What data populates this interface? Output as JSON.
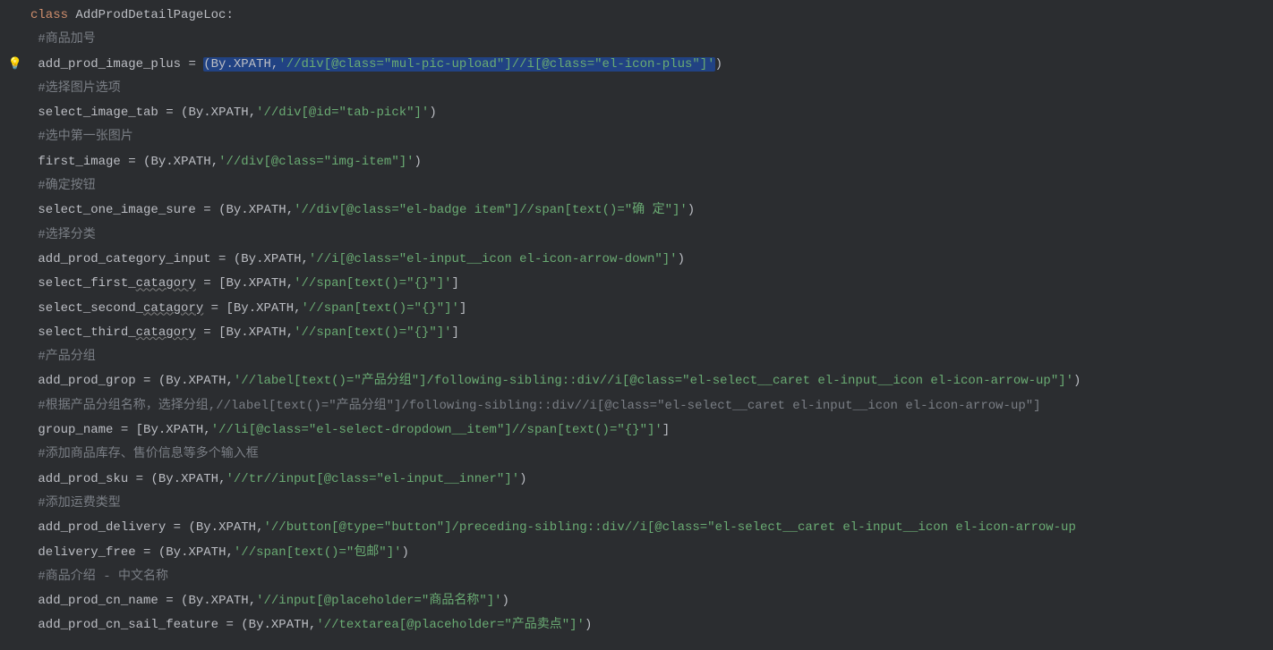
{
  "code": {
    "l1_kw": "class",
    "l1_name": " AddProdDetailPageLoc",
    "l1_colon": ":",
    "l2_comment": "#商品加号",
    "l3_var": "add_prod_image_plus ",
    "l3_eq": "= ",
    "l3_p1": "(",
    "l3_by": "By",
    "l3_dot": ".",
    "l3_xp": "XPATH",
    "l3_comma": ",",
    "l3_str": "'//div[@class=\"mul-pic-upload\"]//i[@class=\"el-icon-plus\"]'",
    "l3_p2": ")",
    "l4_comment": "#选择图片选项",
    "l5_var": "select_image_tab ",
    "l5_eq": "= ",
    "l5_p1": "(",
    "l5_by": "By",
    "l5_dot": ".",
    "l5_xp": "XPATH",
    "l5_comma": ",",
    "l5_str": "'//div[@id=\"tab-pick\"]'",
    "l5_p2": ")",
    "l6_comment": "#选中第一张图片",
    "l7_var": "first_image ",
    "l7_eq": "= ",
    "l7_p1": "(",
    "l7_by": "By",
    "l7_dot": ".",
    "l7_xp": "XPATH",
    "l7_comma": ",",
    "l7_str": "'//div[@class=\"img-item\"]'",
    "l7_p2": ")",
    "l8_comment": "#确定按钮",
    "l9_var": "select_one_image_sure ",
    "l9_eq": "= ",
    "l9_p1": "(",
    "l9_by": "By",
    "l9_dot": ".",
    "l9_xp": "XPATH",
    "l9_comma": ",",
    "l9_str": "'//div[@class=\"el-badge item\"]//span[text()=\"确 定\"]'",
    "l9_p2": ")",
    "l10_comment": "#选择分类",
    "l11_var": "add_prod_category_input ",
    "l11_eq": "= ",
    "l11_p1": "(",
    "l11_by": "By",
    "l11_dot": ".",
    "l11_xp": "XPATH",
    "l11_comma": ",",
    "l11_str": "'//i[@class=\"el-input__icon el-icon-arrow-down\"]'",
    "l11_p2": ")",
    "l12_var_a": "select_first_",
    "l12_var_b": "catagory",
    "l12_eq": " = ",
    "l12_p1": "[",
    "l12_by": "By",
    "l12_dot": ".",
    "l12_xp": "XPATH",
    "l12_comma": ",",
    "l12_str": "'//span[text()=\"{}\"]'",
    "l12_p2": "]",
    "l13_var_a": "select_second_",
    "l13_var_b": "catagory",
    "l13_eq": " = ",
    "l13_p1": "[",
    "l13_by": "By",
    "l13_dot": ".",
    "l13_xp": "XPATH",
    "l13_comma": ",",
    "l13_str": "'//span[text()=\"{}\"]'",
    "l13_p2": "]",
    "l14_var_a": "select_third_",
    "l14_var_b": "catagory",
    "l14_eq": " = ",
    "l14_p1": "[",
    "l14_by": "By",
    "l14_dot": ".",
    "l14_xp": "XPATH",
    "l14_comma": ",",
    "l14_str": "'//span[text()=\"{}\"]'",
    "l14_p2": "]",
    "l15_comment": "#产品分组",
    "l16_var": "add_prod_grop ",
    "l16_eq": "= ",
    "l16_p1": "(",
    "l16_by": "By",
    "l16_dot": ".",
    "l16_xp": "XPATH",
    "l16_comma": ",",
    "l16_str": "'//label[text()=\"产品分组\"]/following-sibling::div//i[@class=\"el-select__caret el-input__icon el-icon-arrow-up\"]'",
    "l16_p2": ")",
    "l17_comment": "#根据产品分组名称，选择分组,//label[text()=\"产品分组\"]/following-sibling::div//i[@class=\"el-select__caret el-input__icon el-icon-arrow-up\"]",
    "l18_var": "group_name ",
    "l18_eq": "= ",
    "l18_p1": "[",
    "l18_by": "By",
    "l18_dot": ".",
    "l18_xp": "XPATH",
    "l18_comma": ",",
    "l18_str": "'//li[@class=\"el-select-dropdown__item\"]//span[text()=\"{}\"]'",
    "l18_p2": "]",
    "l19_comment": "#添加商品库存、售价信息等多个输入框",
    "l20_var": "add_prod_sku ",
    "l20_eq": "= ",
    "l20_p1": "(",
    "l20_by": "By",
    "l20_dot": ".",
    "l20_xp": "XPATH",
    "l20_comma": ",",
    "l20_str": "'//tr//input[@class=\"el-input__inner\"]'",
    "l20_p2": ")",
    "l21_comment": "#添加运费类型",
    "l22_var": "add_prod_delivery ",
    "l22_eq": "= ",
    "l22_p1": "(",
    "l22_by": "By",
    "l22_dot": ".",
    "l22_xp": "XPATH",
    "l22_comma": ",",
    "l22_str": "'//button[@type=\"button\"]/preceding-sibling::div//i[@class=\"el-select__caret el-input__icon el-icon-arrow-up",
    "l23_var": "delivery_free ",
    "l23_eq": "= ",
    "l23_p1": "(",
    "l23_by": "By",
    "l23_dot": ".",
    "l23_xp": "XPATH",
    "l23_comma": ",",
    "l23_str": "'//span[text()=\"包邮\"]'",
    "l23_p2": ")",
    "l24_comment": "#商品介绍 - 中文名称",
    "l25_var": "add_prod_cn_name ",
    "l25_eq": "= ",
    "l25_p1": "(",
    "l25_by": "By",
    "l25_dot": ".",
    "l25_xp": "XPATH",
    "l25_comma": ",",
    "l25_str": "'//input[@placeholder=\"商品名称\"]'",
    "l25_p2": ")",
    "l26_var": "add_prod_cn_sail_feature ",
    "l26_eq": "= ",
    "l26_p1": "(",
    "l26_by": "By",
    "l26_dot": ".",
    "l26_xp": "XPATH",
    "l26_comma": ",",
    "l26_str": "'//textarea[@placeholder=\"产品卖点\"]'",
    "l26_p2": ")"
  }
}
